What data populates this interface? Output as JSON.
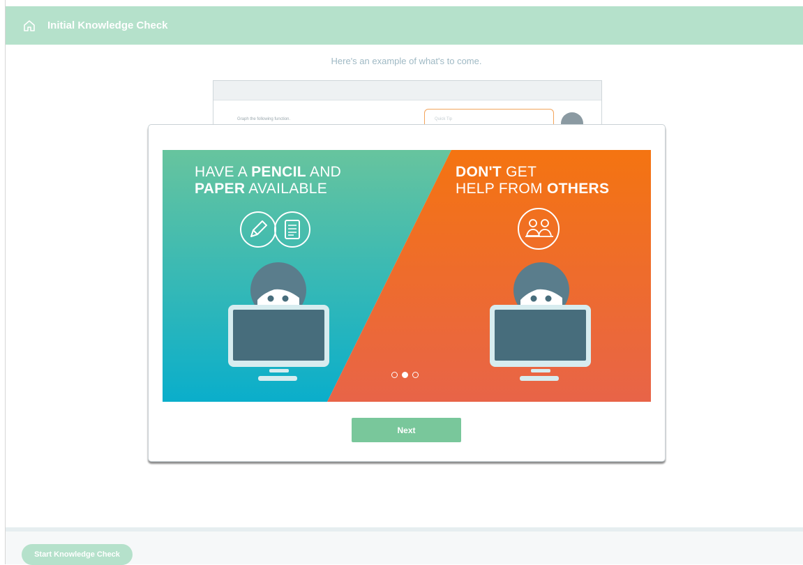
{
  "header": {
    "title": "Initial Knowledge Check",
    "icon": "home-icon"
  },
  "intro_text": "Here's an example of what's to come.",
  "preview": {
    "question_text": "Graph the following function.",
    "tip_label": "Quick Tip"
  },
  "slide": {
    "left_panel": {
      "line1_a": "HAVE A ",
      "line1_b": "PENCIL",
      "line1_c": " AND",
      "line2_a": "PAPER",
      "line2_b": " AVAILABLE",
      "icons": [
        "pencil-icon",
        "document-icon"
      ]
    },
    "right_panel": {
      "line1_a": "DON'T",
      "line1_b": " GET",
      "line2_a": "HELP FROM ",
      "line2_b": "OTHERS",
      "icons": [
        "people-icon"
      ]
    },
    "carousel": {
      "total": 3,
      "active_index": 1
    }
  },
  "next_button": "Next",
  "footer": {
    "start_button": "Start Knowledge Check"
  },
  "colors": {
    "header": "#b5e1cb",
    "button": "#79c79b",
    "teal_top": "#67c49e",
    "teal_bottom": "#0aaecb",
    "orange_top": "#f47411",
    "orange_bottom": "#e86448",
    "avatar": "#5a7d8c",
    "monitor": "#476d7c"
  }
}
